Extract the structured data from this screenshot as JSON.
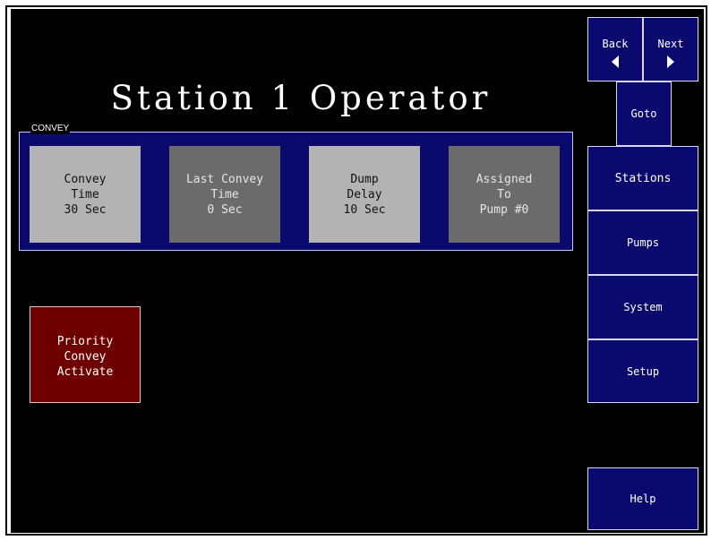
{
  "title": "Station 1 Operator",
  "convey": {
    "group_label": "CONVEY",
    "tiles": [
      {
        "line1": "Convey",
        "line2": "Time",
        "line3": "30 Sec"
      },
      {
        "line1": "Last Convey",
        "line2": "Time",
        "line3": "0 Sec"
      },
      {
        "line1": "Dump",
        "line2": "Delay",
        "line3": "10 Sec"
      },
      {
        "line1": "Assigned",
        "line2": "To",
        "line3": "Pump #0"
      }
    ]
  },
  "priority": {
    "line1": "Priority",
    "line2": "Convey",
    "line3": "Activate"
  },
  "nav": {
    "back": "Back",
    "next": "Next",
    "goto": "Goto",
    "stations": "Stations",
    "pumps": "Pumps",
    "system": "System",
    "setup": "Setup",
    "help": "Help"
  },
  "colors": {
    "background": "#000000",
    "panel_blue": "#0a0a6e",
    "tile_light": "#b3b3b3",
    "tile_dark": "#6b6b6b",
    "priority_red": "#6e0000"
  },
  "icons": {
    "back": "left-triangle-icon",
    "next": "right-triangle-icon"
  }
}
